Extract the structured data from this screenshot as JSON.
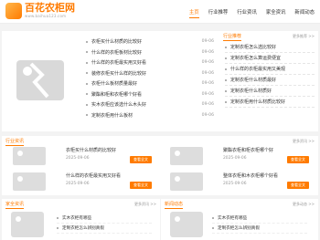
{
  "header": {
    "logo_title": "百花农柜网",
    "logo_url": "www.baihua123.com",
    "nav": [
      "主页",
      "行业推荐",
      "行业资讯",
      "家全资讯",
      "新闻动态"
    ]
  },
  "hero": {
    "items": [
      {
        "title": "衣柜买什么材质的比较好",
        "date": "09-06"
      },
      {
        "title": "什么样的衣柜板材比较好",
        "date": "09-06"
      },
      {
        "title": "什么样的衣柜最实用又好看",
        "date": "09-06"
      },
      {
        "title": "装修衣柜买什么样的比较好",
        "date": "09-06"
      },
      {
        "title": "衣柜什么板材质量最好",
        "date": "09-06"
      },
      {
        "title": "聚酯和柜和衣柜哪个好看",
        "date": "09-06"
      },
      {
        "title": "实木衣柜应该选什么木头好",
        "date": "09-06"
      },
      {
        "title": "定制衣柜用什么板材",
        "date": "09-06"
      }
    ]
  },
  "sidebox": {
    "title": "行业推荐",
    "more": "更多推荐 >>",
    "items": [
      "定制衣柜怎么选比较好",
      "定制衣柜怎么算运费便宜",
      "什么样的衣柜最实用又美观",
      "定制衣柜什么材质最好",
      "定制衣柜什么材质好",
      "定制衣柜用什么材质比较好"
    ]
  },
  "industry": {
    "title": "行业资讯",
    "more": "更多资讯 >>",
    "cards": [
      {
        "title": "衣柜买什么材质的比较好",
        "date": "2025-09-06",
        "button": "查看全文"
      },
      {
        "title": "聚酯衣柜和柜衣柜哪个好",
        "date": "2025-09-06",
        "button": "查看全文"
      },
      {
        "title": "什么样的衣柜最实用又好看",
        "date": "2025-09-06",
        "button": "查看全文"
      },
      {
        "title": "整体衣柜和木衣柜哪个好看",
        "date": "2025-09-06",
        "button": "查看全文"
      }
    ]
  },
  "bottom": [
    {
      "title": "家全资讯",
      "more": "更多资讯 >>",
      "items": [
        "实木衣柜有哪些",
        "定制衣柜怎么辨别真假"
      ]
    },
    {
      "title": "新闻动态",
      "more": "更多动态 >>",
      "items": [
        "实木衣柜有哪些",
        "定制衣柜怎么辨别真假"
      ]
    }
  ],
  "colors": {
    "accent": "#ff7b00"
  }
}
